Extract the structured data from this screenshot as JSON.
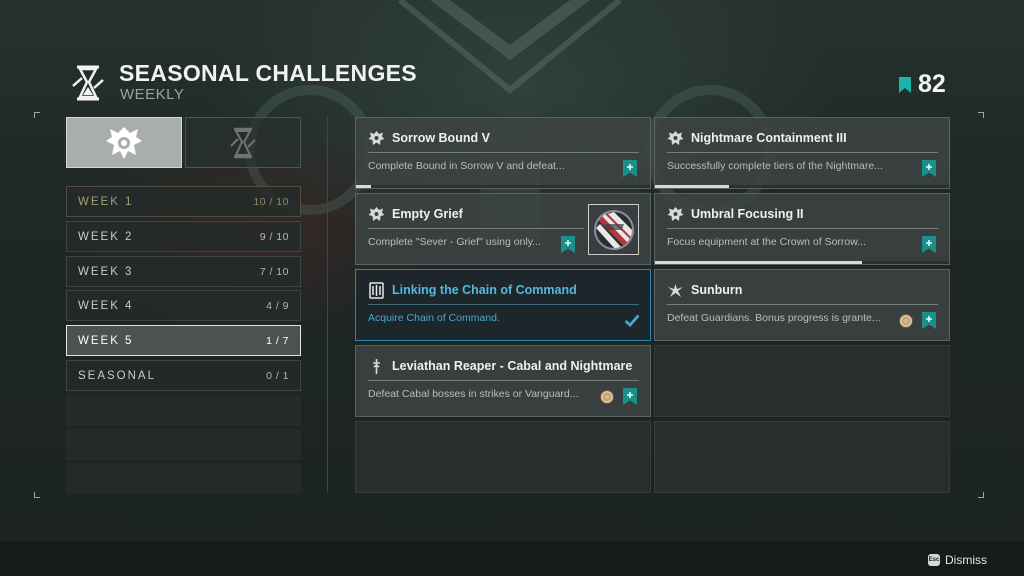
{
  "header": {
    "title": "SEASONAL CHALLENGES",
    "subtitle": "WEEKLY",
    "score": "82"
  },
  "tabs": [
    {
      "name": "seasonal-emblem-tab",
      "icon": "season-emblem-icon",
      "selected": true
    },
    {
      "name": "hourglass-tab",
      "icon": "hourglass-icon",
      "selected": false
    }
  ],
  "weeks": [
    {
      "label": "WEEK 1",
      "count": "10 / 10",
      "state": "done"
    },
    {
      "label": "WEEK 2",
      "count": "9 / 10",
      "state": "normal"
    },
    {
      "label": "WEEK 3",
      "count": "7 / 10",
      "state": "normal"
    },
    {
      "label": "WEEK 4",
      "count": "4 / 9",
      "state": "normal"
    },
    {
      "label": "WEEK 5",
      "count": "1 / 7",
      "state": "active"
    },
    {
      "label": "SEASONAL",
      "count": "0 / 1",
      "state": "normal"
    }
  ],
  "challenges": [
    {
      "title": "Sorrow Bound V",
      "desc": "Complete Bound in Sorrow V and defeat...",
      "icon": "crest-icon",
      "progress": 0.05,
      "reward": "bookmark"
    },
    {
      "title": "Nightmare Containment III",
      "desc": "Successfully complete tiers of the Nightmare...",
      "icon": "crest-icon",
      "progress": 0.25,
      "reward": "bookmark"
    },
    {
      "title": "Empty Grief",
      "desc": "Complete \"Sever - Grief\" using only...",
      "icon": "crest-icon",
      "progress": 0,
      "reward": "bookmark",
      "item_reward": "striped-shader-icon"
    },
    {
      "title": "Umbral Focusing II",
      "desc": "Focus equipment at the Crown of Sorrow...",
      "icon": "crest-icon",
      "progress": 0.7,
      "reward": "bookmark"
    },
    {
      "title": "Linking the Chain of Command",
      "desc": "Acquire Chain of Command.",
      "icon": "shield-icon",
      "progress": 1,
      "reward": "checkmark",
      "state": "completed"
    },
    {
      "title": "Sunburn",
      "desc": "Defeat Guardians. Bonus progress is grante...",
      "icon": "winged-emblem-icon",
      "progress": 0,
      "reward": "bookmark",
      "bonus": "medal"
    },
    {
      "title": "Leviathan Reaper - Cabal and Nightmare...",
      "desc": "Defeat Cabal bosses in strikes or Vanguard...",
      "icon": "dagger-icon",
      "progress": 0,
      "reward": "bookmark",
      "bonus": "medal"
    }
  ],
  "footer": {
    "esc_key": "Esc",
    "dismiss": "Dismiss"
  },
  "colors": {
    "accent_teal": "#1aa3a0",
    "selected_blue": "#2f86ad",
    "completed_gold": "#a79f78"
  }
}
